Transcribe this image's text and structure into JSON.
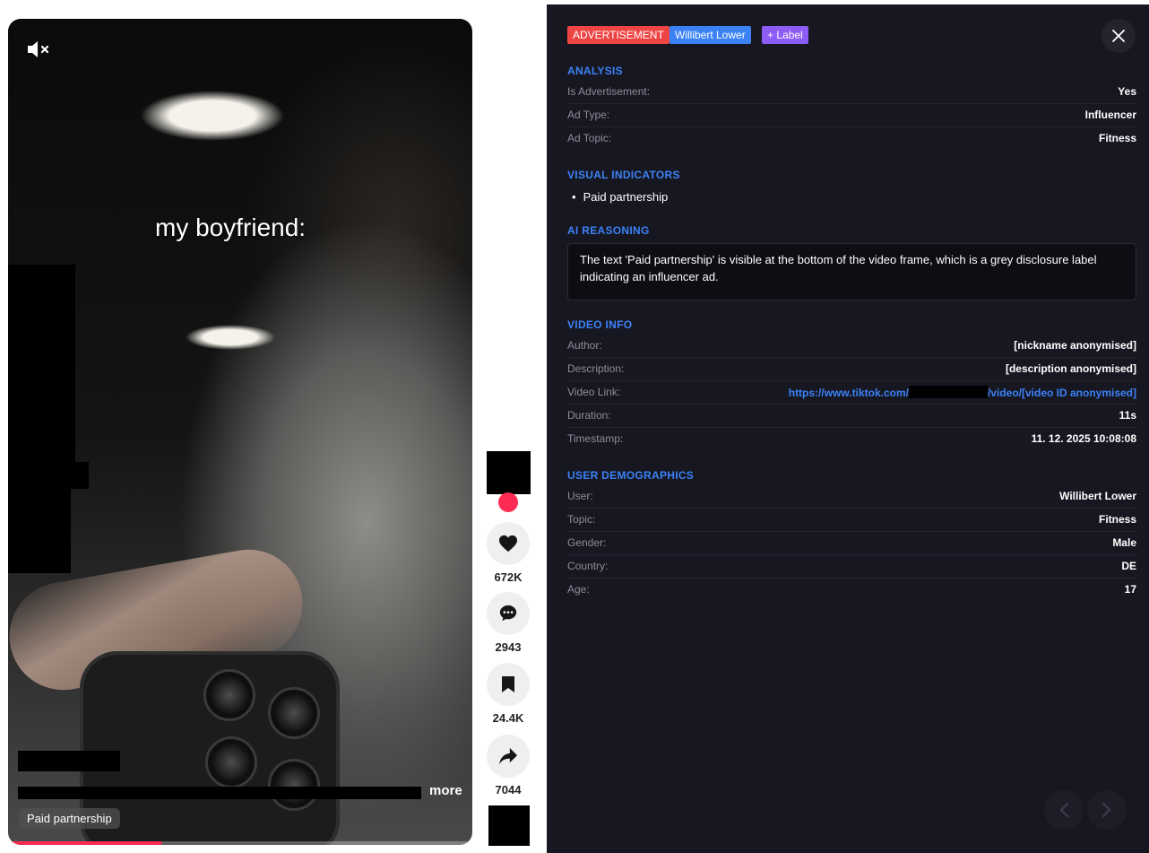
{
  "video": {
    "overlay_text": "my boyfriend:",
    "more_label": "more",
    "paid_badge": "Paid partnership",
    "progress": 0.33
  },
  "rail": {
    "likes": "672K",
    "comments": "2943",
    "saves": "24.4K",
    "shares": "7044"
  },
  "panel": {
    "tags": {
      "advertisement": "ADVERTISEMENT",
      "user": "Willibert Lower",
      "add_label": "+ Label"
    },
    "analysis": {
      "title": "ANALYSIS",
      "rows": [
        {
          "key": "Is Advertisement:",
          "value": "Yes"
        },
        {
          "key": "Ad Type:",
          "value": "Influencer"
        },
        {
          "key": "Ad Topic:",
          "value": "Fitness"
        }
      ]
    },
    "visual_indicators": {
      "title": "VISUAL INDICATORS",
      "items": [
        "Paid partnership"
      ]
    },
    "ai_reasoning": {
      "title": "AI REASONING",
      "text": "The text 'Paid partnership' is visible at the bottom of the video frame, which is a grey disclosure label indicating an influencer ad."
    },
    "video_info": {
      "title": "VIDEO INFO",
      "rows": [
        {
          "key": "Author:",
          "value": "[nickname anonymised]"
        },
        {
          "key": "Description:",
          "value": "[description anonymised]"
        },
        {
          "key": "Video Link:",
          "value_prefix": "https://www.tiktok.com/",
          "value_suffix": "/video/[video ID anonymised]"
        },
        {
          "key": "Duration:",
          "value": "11s"
        },
        {
          "key": "Timestamp:",
          "value": "11. 12. 2025 10:08:08"
        }
      ]
    },
    "user_demographics": {
      "title": "USER DEMOGRAPHICS",
      "rows": [
        {
          "key": "User:",
          "value": "Willibert Lower"
        },
        {
          "key": "Topic:",
          "value": "Fitness"
        },
        {
          "key": "Gender:",
          "value": "Male"
        },
        {
          "key": "Country:",
          "value": "DE"
        },
        {
          "key": "Age:",
          "value": "17"
        }
      ]
    }
  },
  "colors": {
    "accent_blue": "#3b82f6",
    "ad_red": "#ef4444",
    "user_blue": "#3b82f6",
    "label_purple": "#8b5cf6",
    "tiktok_red": "#fe2c55"
  },
  "icons": {
    "mute": "speaker-muted-icon",
    "like": "heart-icon",
    "comment": "comment-icon",
    "save": "bookmark-icon",
    "share": "share-arrow-icon",
    "close": "close-icon",
    "prev": "chevron-left-icon",
    "next": "chevron-right-icon"
  }
}
